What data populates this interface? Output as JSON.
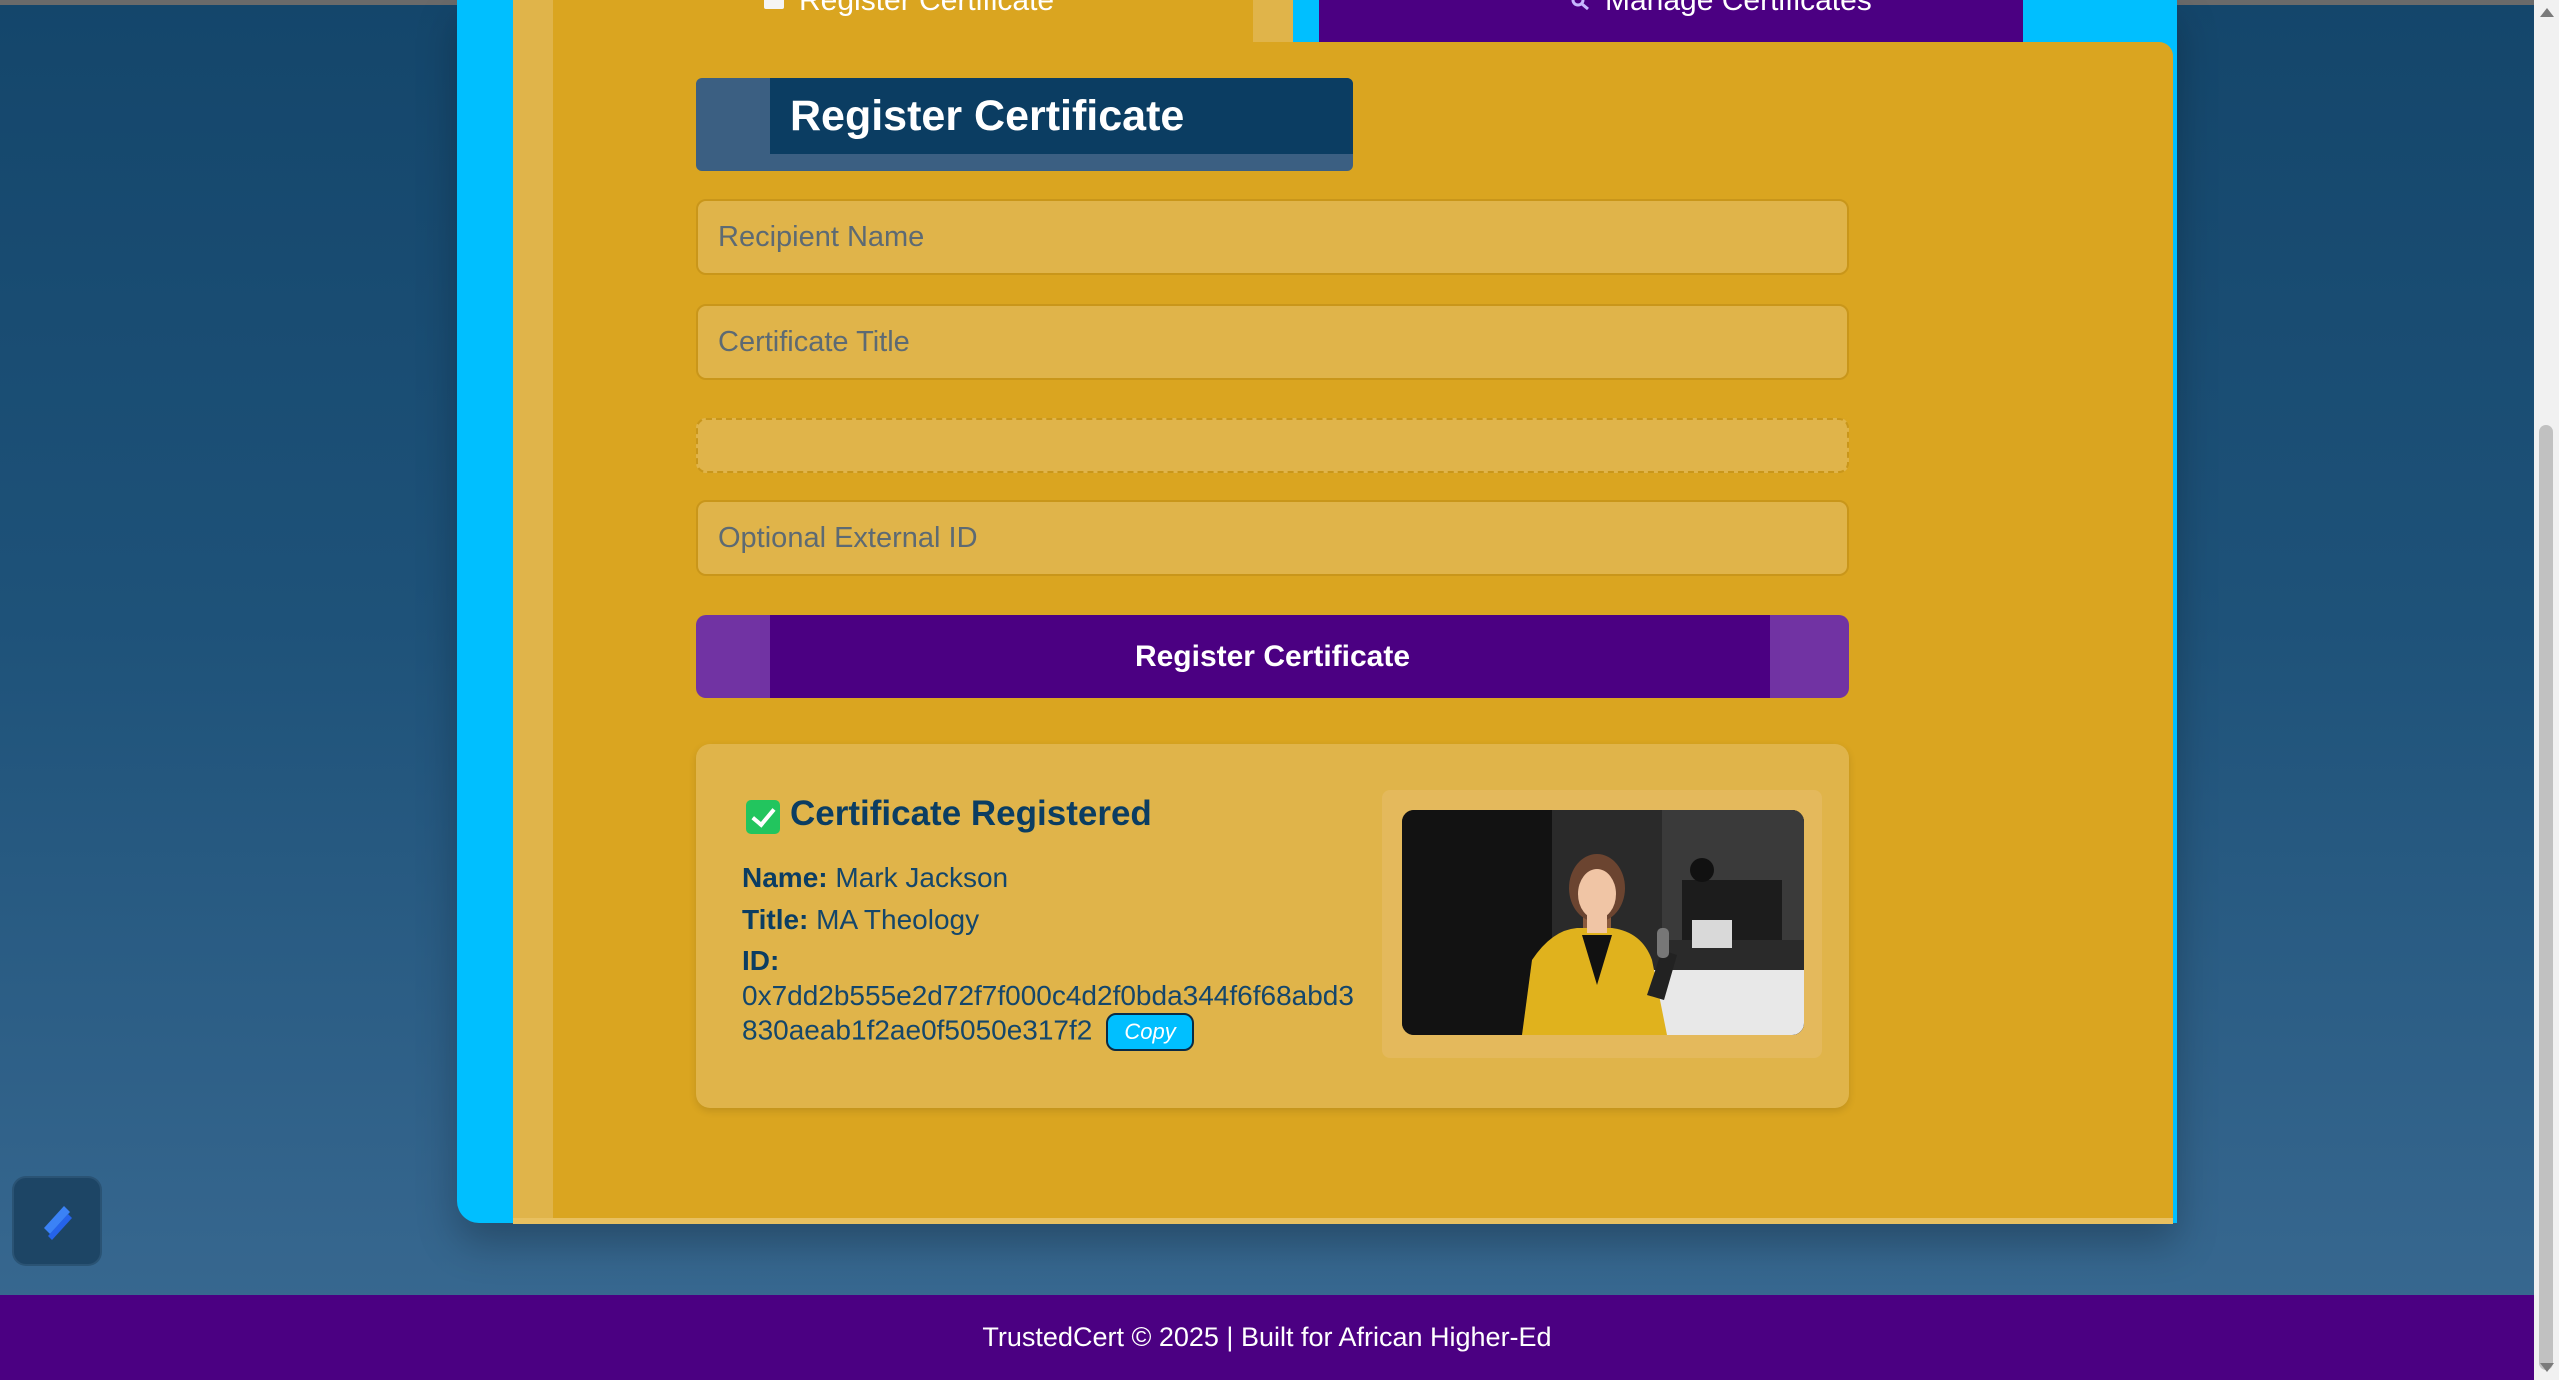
{
  "tabs": {
    "register_label": "Register Certificate",
    "manage_label": "Manage Certificates"
  },
  "form": {
    "heading": "Register Certificate",
    "recipient_placeholder": "Recipient Name",
    "title_placeholder": "Certificate Title",
    "external_id_placeholder": "Optional External ID",
    "submit_label": "Register Certificate"
  },
  "result": {
    "title": "Certificate Registered",
    "name_label": "Name:",
    "name_value": "Mark Jackson",
    "title_label": "Title:",
    "title_value": "MA Theology",
    "id_label": "ID:",
    "id_value": "0x7dd2b555e2d72f7f000c4d2f0bda344f6f68abd3830aeab1f2ae0f5050e317f2",
    "copy_label": "Copy"
  },
  "footer": {
    "text": "TrustedCert © 2025 | Built for African Higher-Ed"
  },
  "colors": {
    "gold": "#daa520",
    "purple": "#4b0082",
    "cyan": "#00bfff",
    "navy": "#0b3d62",
    "success": "#22c55e"
  }
}
